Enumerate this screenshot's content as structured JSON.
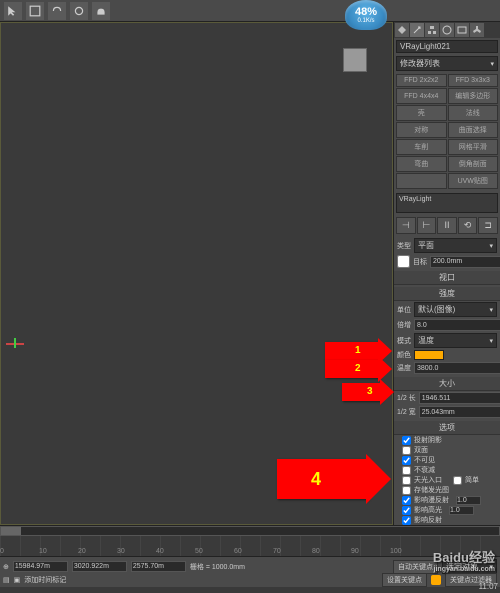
{
  "progress": {
    "percent": "48%",
    "speed": "0.1K/s"
  },
  "object_name": "VRayLight021",
  "modifier_list": "修改器列表",
  "modifier_buttons": [
    "FFD 2x2x2",
    "FFD 3x3x3",
    "FFD 4x4x4",
    "编辑多边形",
    "壳",
    "法线",
    "对称",
    "曲面选择",
    "车削",
    "网格平滑",
    "弯曲",
    "倒角剖面",
    "",
    "UVW贴图"
  ],
  "preview_name": "VRayLight",
  "align_buttons": [
    "⊣",
    "⊢",
    "II",
    "⟲",
    "⊐"
  ],
  "params": {
    "type_row": {
      "label": "类型",
      "value": "平面"
    },
    "target_row": {
      "label": "目标",
      "value": "200.0mm"
    },
    "viewport_section": "视口",
    "intensity_section": "强度",
    "unit_row": {
      "label": "单位",
      "value": "默认(图像)"
    },
    "multiplier_row": {
      "label": "倍增",
      "value": "8.0"
    },
    "mode_row": {
      "label": "模式",
      "value": "温度"
    },
    "color_row": {
      "label": "颜色"
    },
    "temp_row": {
      "label": "温度",
      "value": "3800.0"
    },
    "size_section": "大小",
    "half_length": {
      "label": "1/2 长",
      "value": "1946.511"
    },
    "half_width": {
      "label": "1/2 宽",
      "value": "25.043mm"
    },
    "options_section": "选项",
    "opt1": "投射阴影",
    "opt2": "双面",
    "opt3": "不可见",
    "opt4": "不衰减",
    "opt5": "天光入口",
    "opt5b": "简单",
    "opt6": "存储发光图",
    "opt7": "影响漫反射",
    "opt7v": "1.0",
    "opt8": "影响高光",
    "opt8v": "1.0",
    "opt9": "影响反射"
  },
  "timeline": {
    "ticks": [
      "0",
      "10",
      "20",
      "30",
      "40",
      "50",
      "60",
      "70",
      "80",
      "90",
      "100"
    ]
  },
  "status": {
    "x": "15984.97m",
    "y": "3020.922m",
    "z": "2575.70m",
    "grid": "栅格 = 1000.0mm",
    "auto_key": "自动关键点",
    "sel_filter": "选定对象",
    "set_key": "设置关键点",
    "key_filter": "关键点过滤器",
    "add_time_tag": "添加时间标记"
  },
  "arrows": {
    "a1": "1",
    "a2": "2",
    "a3": "3",
    "a4": "4"
  },
  "watermark": {
    "main": "Baidu经验",
    "sub": "jingyan.baidu.com"
  },
  "clock": "11:07"
}
